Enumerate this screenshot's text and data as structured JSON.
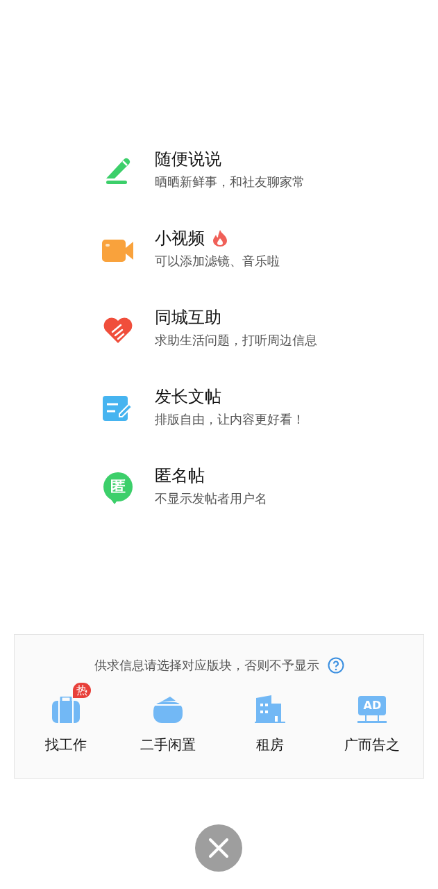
{
  "post_menu": [
    {
      "kind": "pencil",
      "title": "随便说说",
      "subtitle": "晒晒新鲜事，和社友聊家常",
      "hot": false
    },
    {
      "kind": "video",
      "title": "小视频",
      "subtitle": "可以添加滤镜、音乐啦",
      "hot": true
    },
    {
      "kind": "heart",
      "title": "同城互助",
      "subtitle": "求助生活问题，打听周边信息",
      "hot": false
    },
    {
      "kind": "article",
      "title": "发长文帖",
      "subtitle": "排版自由，让内容更好看！",
      "hot": false
    },
    {
      "kind": "anonymous",
      "title": "匿名帖",
      "subtitle": "不显示发帖者用户名",
      "hot": false,
      "icon_text": "匿"
    }
  ],
  "category_panel": {
    "notice": "供求信息请选择对应版块，否则不予显示",
    "items": [
      {
        "kind": "job",
        "label": "找工作",
        "badge": "热"
      },
      {
        "kind": "secondhand",
        "label": "二手闲置"
      },
      {
        "kind": "rent",
        "label": "租房"
      },
      {
        "kind": "ad",
        "label": "广而告之",
        "icon_text": "AD"
      }
    ]
  }
}
